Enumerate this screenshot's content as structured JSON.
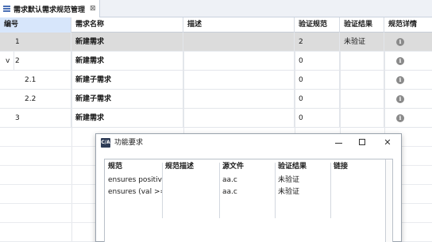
{
  "tab": {
    "title": "需求默认需求规范管理",
    "close": "⊠"
  },
  "table": {
    "headers": [
      "编号",
      "需求名称",
      "描述",
      "验证规范",
      "验证结果",
      "规范详情"
    ],
    "rows": [
      {
        "id": "1",
        "name": "新建需求",
        "desc": "",
        "spec": "2",
        "result": "未验证",
        "expand": "",
        "selected": true
      },
      {
        "id": "2",
        "name": "新建需求",
        "desc": "",
        "spec": "0",
        "result": "",
        "expand": "v",
        "selected": false
      },
      {
        "id": "2.1",
        "name": "新建子需求",
        "desc": "",
        "spec": "0",
        "result": "",
        "expand": "",
        "selected": false
      },
      {
        "id": "2.2",
        "name": "新建子需求",
        "desc": "",
        "spec": "0",
        "result": "",
        "expand": "",
        "selected": false
      },
      {
        "id": "3",
        "name": "新建需求",
        "desc": "",
        "spec": "0",
        "result": "",
        "expand": "",
        "selected": false
      }
    ],
    "info_icon": "i"
  },
  "dialog": {
    "title": "功能要求",
    "icon_text": "C/A",
    "close": "✕",
    "headers": [
      "规范",
      "规范描述",
      "源文件",
      "验证结果",
      "链接"
    ],
    "rows": [
      {
        "spec": "ensures positiv...",
        "desc": "",
        "file": "aa.c",
        "result": "未验证",
        "link": ""
      },
      {
        "spec": "ensures (val >=...",
        "desc": "",
        "file": "aa.c",
        "result": "未验证",
        "link": ""
      }
    ]
  }
}
